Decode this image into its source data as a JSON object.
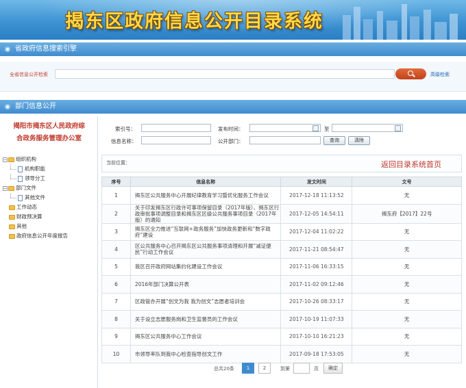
{
  "banner": {
    "title": "揭东区政府信息公开目录系统"
  },
  "search_section": {
    "title": "省政府信息搜索引擎",
    "label": "全省信息公开检索",
    "input_value": "",
    "advanced_label": "高级检索"
  },
  "dept_section": {
    "title": "部门信息公开"
  },
  "sidebar": {
    "org_line1": "揭阳市揭东区人民政府综",
    "org_line2": "合政务服务管理办公室",
    "tree": [
      {
        "label": "组织机构",
        "type": "folder",
        "expanded": true
      },
      {
        "label": "机构职能",
        "type": "doc",
        "level": 1
      },
      {
        "label": "领导分工",
        "type": "doc",
        "level": 1
      },
      {
        "label": "部门文件",
        "type": "folder",
        "expanded": true
      },
      {
        "label": "其他文件",
        "type": "doc",
        "level": 1
      },
      {
        "label": "工作动态",
        "type": "folder"
      },
      {
        "label": "财政预决算",
        "type": "folder"
      },
      {
        "label": "其他",
        "type": "folder"
      },
      {
        "label": "政府信息公开年度报告",
        "type": "folder"
      }
    ]
  },
  "filter": {
    "index_label": "索引号：",
    "date_label": "发布时间：",
    "to_label": "至",
    "name_label": "信息名称：",
    "dept_label": "公开部门：",
    "query_button": "查询",
    "clear_button": "清除"
  },
  "location": {
    "label": "当前位置：",
    "home_link": "返回目录系统首页"
  },
  "table": {
    "headers": [
      "序号",
      "信息名称",
      "发文时间",
      "文号"
    ],
    "rows": [
      {
        "no": "1",
        "name": "揭东区公共服务中心开展纪律教育学习暨优化服务工作会议",
        "time": "2017-12-18 11:13:52",
        "doc": "无"
      },
      {
        "no": "2",
        "name": "关于印发揭东区行政许可事项保留目录（2017年版）、揭东区行政审批事项调整目录和揭东区区级公共服务事项目录（2017年版）的通知",
        "time": "2017-12-05 14:54:11",
        "doc": "揭东府【2017】22号"
      },
      {
        "no": "3",
        "name": "揭东区全力推进“互联网+政务服务”加快政务更新和“数字政府”建设",
        "time": "2017-12-04 11:02:22",
        "doc": "无"
      },
      {
        "no": "4",
        "name": "区公共服务中心召开揭东区公共服务事项清理和开展“减证便民”行动工作会议",
        "time": "2017-11-21 08:54:47",
        "doc": "无"
      },
      {
        "no": "5",
        "name": "我区召开政府网站集约化建设工作会议",
        "time": "2017-11-06 16:33:15",
        "doc": "无"
      },
      {
        "no": "6",
        "name": "2016年部门决算公开表",
        "time": "2017-11-02 09:12:46",
        "doc": "无"
      },
      {
        "no": "7",
        "name": "区政管办开展“创文为我 我为创文”志愿者培训会",
        "time": "2017-10-26 08:33:17",
        "doc": "无"
      },
      {
        "no": "8",
        "name": "关于设立志愿服务岗和卫生监督员的工作会议",
        "time": "2017-10-19 11:07:33",
        "doc": "无"
      },
      {
        "no": "9",
        "name": "揭东区公共服务中心工作会议",
        "time": "2017-10-10 16:21:23",
        "doc": "无"
      },
      {
        "no": "10",
        "name": "市领导率队到我中心检查指导创文工作",
        "time": "2017-09-18 17:53:05",
        "doc": "无"
      }
    ]
  },
  "pager": {
    "total": "总共20条",
    "page1": "1",
    "page2": "2",
    "goto_label": "到第",
    "page_unit": "页",
    "ok_label": "确定"
  },
  "colors": {
    "banner": "#3d93d3",
    "accent_red": "#c0392b",
    "title_yellow": "#ffd84a"
  }
}
